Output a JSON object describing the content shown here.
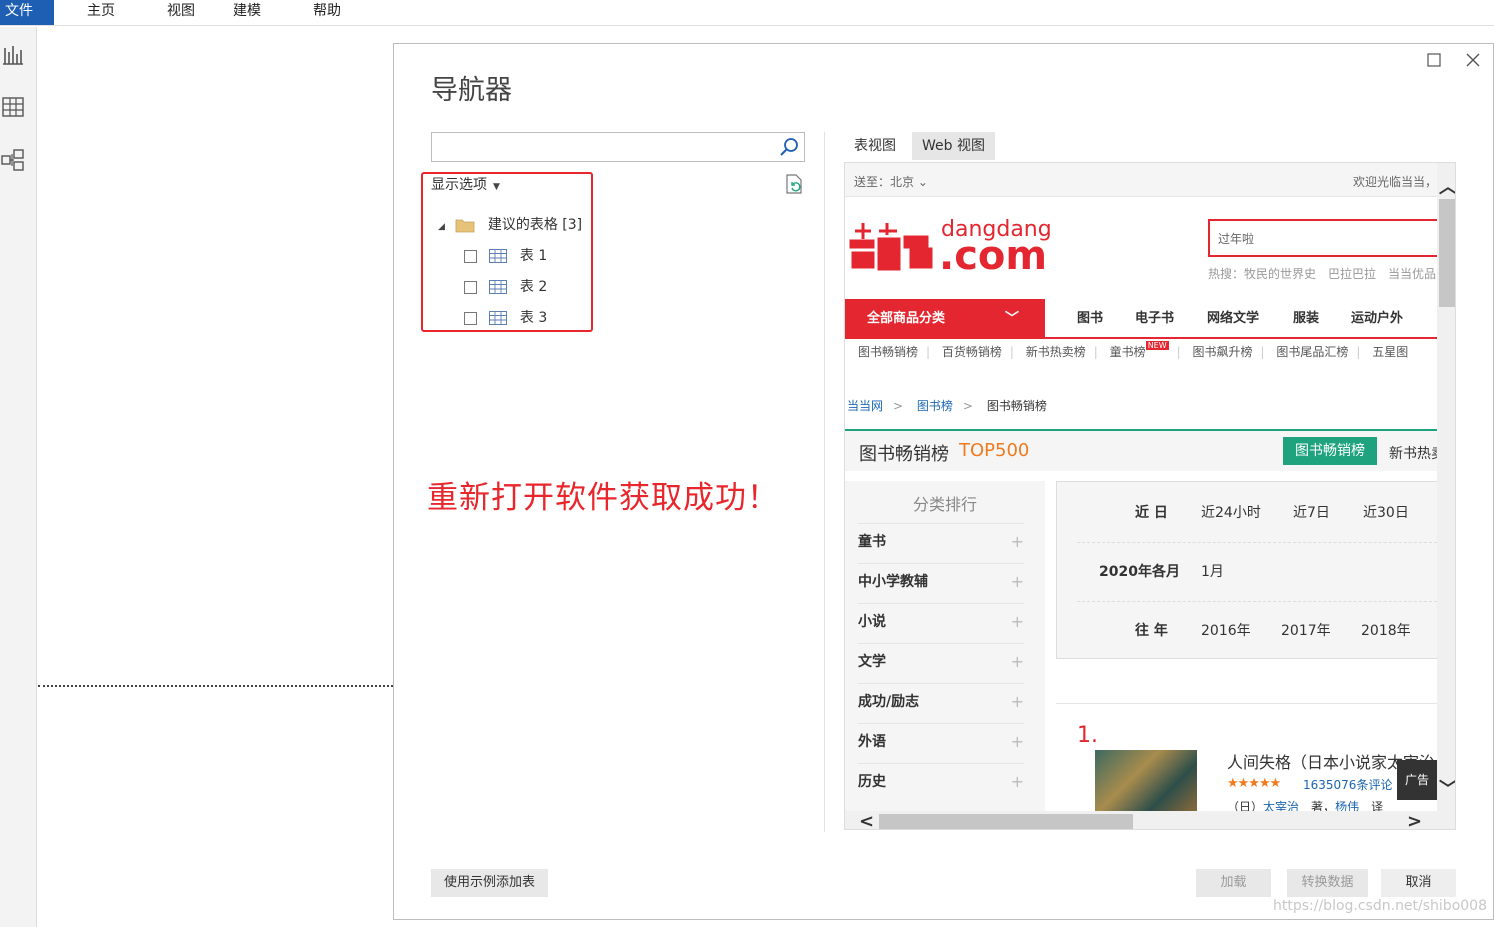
{
  "menubar": {
    "file": "文件",
    "items": [
      "主页",
      "视图",
      "建模",
      "帮助"
    ]
  },
  "dialog": {
    "title": "导航器",
    "search_placeholder": "",
    "display_options": "显示选项",
    "folder_label": "建议的表格 [3]",
    "tables": [
      "表 1",
      "表 2",
      "表 3"
    ],
    "success_note": "重新打开软件获取成功！",
    "tabs": [
      "表视图",
      "Web 视图"
    ],
    "buttons": {
      "add_table": "使用示例添加表",
      "load": "加载",
      "transform": "转换数据",
      "cancel": "取消"
    }
  },
  "web": {
    "ship_to": "送至：北京",
    "welcome": "欢迎光临当当，",
    "logo_word": "dangdang",
    "logo_com": ".com",
    "search_value": "过年啦",
    "hot_words": "热搜：牧民的世界史　巴拉巴拉　当当优品",
    "all_categories": "全部商品分类",
    "nav": [
      "图书",
      "电子书",
      "网络文学",
      "服装",
      "运动户外"
    ],
    "subnav": [
      "图书畅销榜",
      "百货畅销榜",
      "新书热卖榜",
      "童书榜",
      "图书飙升榜",
      "图书尾品汇榜",
      "五星图"
    ],
    "new_badge": "NEW",
    "breadcrumb": [
      "当当网",
      "图书榜",
      "图书畅销榜"
    ],
    "rank_title": "图书畅销榜",
    "rank_top": "TOP500",
    "rank_button": "图书畅销榜",
    "rank_new": "新书热卖",
    "side_head": "分类排行",
    "side_items": [
      "童书",
      "中小学教辅",
      "小说",
      "文学",
      "成功/励志",
      "外语",
      "历史"
    ],
    "date": {
      "recent_label": "近 日",
      "recent": [
        "近24小时",
        "近7日",
        "近30日"
      ],
      "month_label": "2020年各月",
      "month": "1月",
      "year_label": "往 年",
      "years": [
        "2016年",
        "2017年",
        "2018年"
      ]
    },
    "rank_no": "1.",
    "book_title": "人间失格（日本小说家太宰治",
    "stars": "★★★★★",
    "reviews": "1635076条评论",
    "author_prefix": "（日）",
    "author": "太宰治",
    "author_mid": "著，",
    "translator": "杨伟",
    "author_suffix": "译",
    "ad": "广告"
  },
  "watermark": "https://blog.csdn.net/shibo008",
  "colors": {
    "accent_red": "#e8262c",
    "dangdang_red": "#e3262f",
    "green": "#1fa37f",
    "ribbon_blue": "#1e5fb3"
  }
}
